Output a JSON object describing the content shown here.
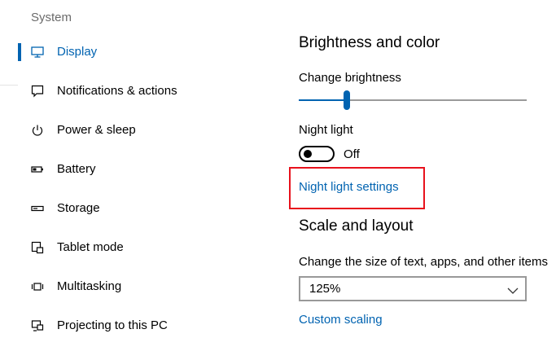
{
  "sidebar": {
    "title": "System",
    "items": [
      {
        "label": "Display",
        "icon": "monitor-icon",
        "active": true
      },
      {
        "label": "Notifications & actions",
        "icon": "notification-icon"
      },
      {
        "label": "Power & sleep",
        "icon": "power-icon"
      },
      {
        "label": "Battery",
        "icon": "battery-icon"
      },
      {
        "label": "Storage",
        "icon": "storage-icon"
      },
      {
        "label": "Tablet mode",
        "icon": "tablet-mode-icon"
      },
      {
        "label": "Multitasking",
        "icon": "multitasking-icon"
      },
      {
        "label": "Projecting to this PC",
        "icon": "projecting-icon"
      }
    ]
  },
  "brightness": {
    "heading": "Brightness and color",
    "change_label": "Change brightness",
    "level": 0.21,
    "night_light_label": "Night light",
    "night_light_state": "Off",
    "night_light_settings_link": "Night light settings"
  },
  "scale": {
    "heading": "Scale and layout",
    "size_label": "Change the size of text, apps, and other items",
    "size_value": "125%",
    "custom_scaling_link": "Custom scaling"
  },
  "colors": {
    "accent": "#0063b1",
    "highlight_box": "#e8111c"
  }
}
